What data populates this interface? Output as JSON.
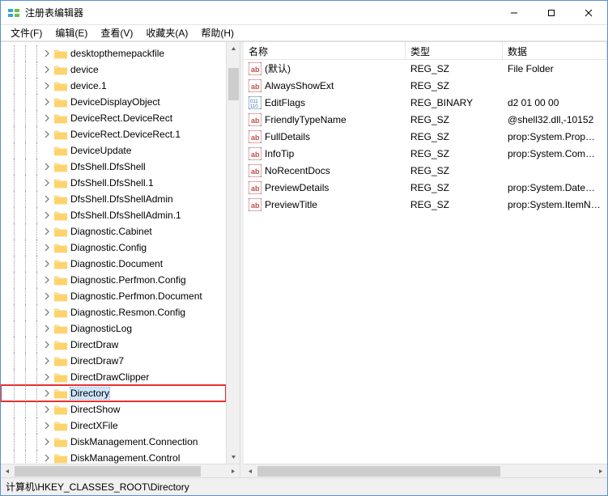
{
  "window": {
    "title": "注册表编辑器"
  },
  "menu": {
    "file": "文件(F)",
    "edit": "编辑(E)",
    "view": "查看(V)",
    "favorites": "收藏夹(A)",
    "help": "帮助(H)"
  },
  "tree": {
    "items": [
      {
        "label": "desktopthemepackfile",
        "expandable": true
      },
      {
        "label": "device",
        "expandable": true
      },
      {
        "label": "device.1",
        "expandable": true
      },
      {
        "label": "DeviceDisplayObject",
        "expandable": true
      },
      {
        "label": "DeviceRect.DeviceRect",
        "expandable": true
      },
      {
        "label": "DeviceRect.DeviceRect.1",
        "expandable": true
      },
      {
        "label": "DeviceUpdate",
        "expandable": false
      },
      {
        "label": "DfsShell.DfsShell",
        "expandable": true
      },
      {
        "label": "DfsShell.DfsShell.1",
        "expandable": true
      },
      {
        "label": "DfsShell.DfsShellAdmin",
        "expandable": true
      },
      {
        "label": "DfsShell.DfsShellAdmin.1",
        "expandable": true
      },
      {
        "label": "Diagnostic.Cabinet",
        "expandable": true
      },
      {
        "label": "Diagnostic.Config",
        "expandable": true
      },
      {
        "label": "Diagnostic.Document",
        "expandable": true
      },
      {
        "label": "Diagnostic.Perfmon.Config",
        "expandable": true
      },
      {
        "label": "Diagnostic.Perfmon.Document",
        "expandable": true
      },
      {
        "label": "Diagnostic.Resmon.Config",
        "expandable": true
      },
      {
        "label": "DiagnosticLog",
        "expandable": true
      },
      {
        "label": "DirectDraw",
        "expandable": true
      },
      {
        "label": "DirectDraw7",
        "expandable": true
      },
      {
        "label": "DirectDrawClipper",
        "expandable": true
      },
      {
        "label": "Directory",
        "expandable": true,
        "selected": true,
        "highlighted": true
      },
      {
        "label": "DirectShow",
        "expandable": true
      },
      {
        "label": "DirectXFile",
        "expandable": true
      },
      {
        "label": "DiskManagement.Connection",
        "expandable": true
      },
      {
        "label": "DiskManagement.Control",
        "expandable": true
      }
    ]
  },
  "list": {
    "columns": {
      "name": "名称",
      "type": "类型",
      "data": "数据"
    },
    "rows": [
      {
        "kind": "string",
        "name": "(默认)",
        "type": "REG_SZ",
        "data": "File Folder"
      },
      {
        "kind": "string",
        "name": "AlwaysShowExt",
        "type": "REG_SZ",
        "data": ""
      },
      {
        "kind": "binary",
        "name": "EditFlags",
        "type": "REG_BINARY",
        "data": "d2 01 00 00"
      },
      {
        "kind": "string",
        "name": "FriendlyTypeName",
        "type": "REG_SZ",
        "data": "@shell32.dll,-10152"
      },
      {
        "kind": "string",
        "name": "FullDetails",
        "type": "REG_SZ",
        "data": "prop:System.PropGroup…"
      },
      {
        "kind": "string",
        "name": "InfoTip",
        "type": "REG_SZ",
        "data": "prop:System.Comment…"
      },
      {
        "kind": "string",
        "name": "NoRecentDocs",
        "type": "REG_SZ",
        "data": ""
      },
      {
        "kind": "string",
        "name": "PreviewDetails",
        "type": "REG_SZ",
        "data": "prop:System.DateMod…"
      },
      {
        "kind": "string",
        "name": "PreviewTitle",
        "type": "REG_SZ",
        "data": "prop:System.ItemNam…"
      }
    ]
  },
  "statusbar": {
    "path": "计算机\\HKEY_CLASSES_ROOT\\Directory"
  }
}
